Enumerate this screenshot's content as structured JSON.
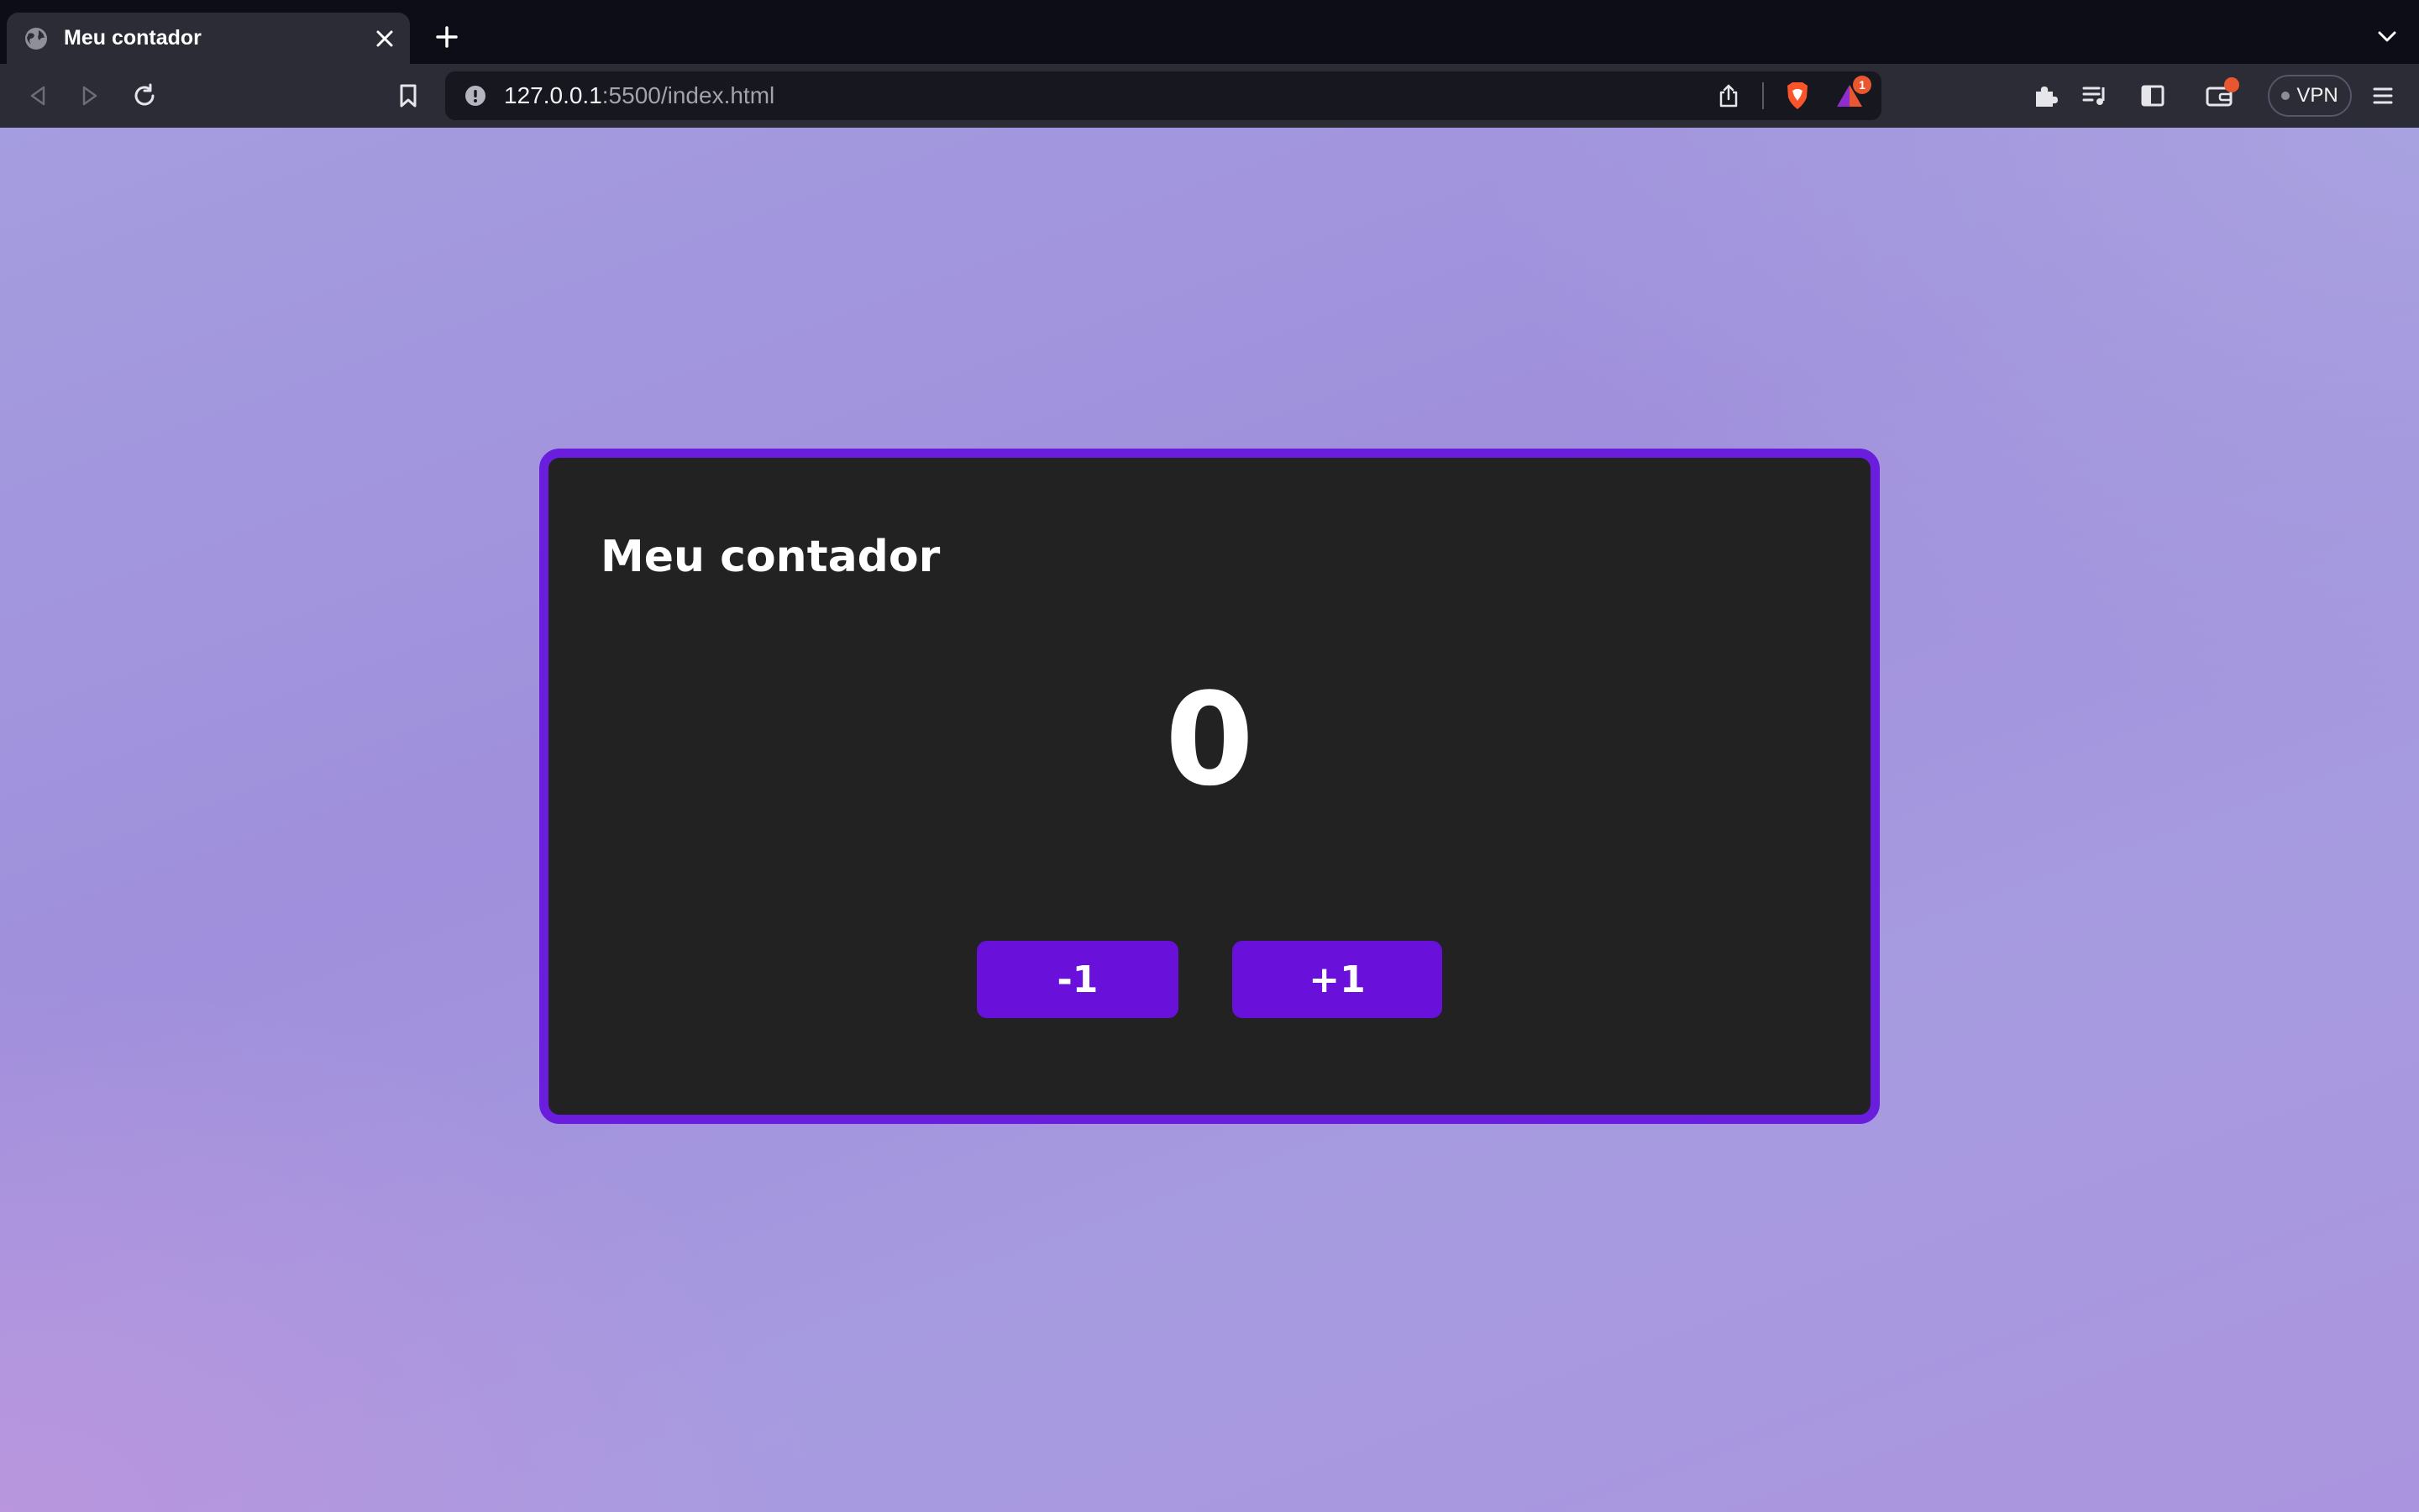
{
  "browser": {
    "tab": {
      "title": "Meu contador"
    },
    "url": {
      "host": "127.0.0.1",
      "path": ":5500/index.html"
    },
    "alerts_badge": "1",
    "vpn_label": "VPN"
  },
  "page": {
    "title": "Meu contador",
    "counter_value": "0",
    "decrement_label": "-1",
    "increment_label": "+1"
  },
  "colors": {
    "card_border": "#6a1ddc",
    "card_background": "#222222",
    "button": "#6a10db",
    "background_lavender": "#a49ddf"
  },
  "icons": [
    "globe-icon",
    "close-icon",
    "plus-icon",
    "chevron-down-icon",
    "back-icon",
    "forward-icon",
    "reload-icon",
    "bookmark-icon",
    "info-icon",
    "share-icon",
    "brave-shield-icon",
    "brave-rewards-icon",
    "puzzle-icon",
    "playlist-icon",
    "sidebar-icon",
    "wallet-icon",
    "menu-icon"
  ]
}
